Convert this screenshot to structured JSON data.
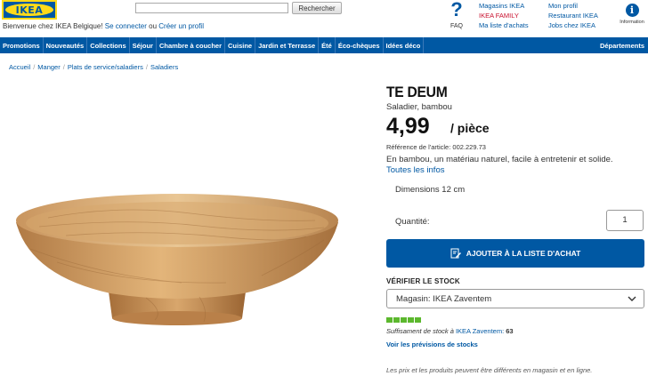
{
  "brand": {
    "logo_text": "IKEA",
    "primary_color": "#0058a3",
    "accent_color": "#ffda1a"
  },
  "header": {
    "welcome_text": "Bienvenue chez IKEA Belgique!",
    "login_link": "Se connecter",
    "or_text": "ou",
    "create_profile_link": "Créer un profil",
    "search_placeholder": "",
    "search_button": "Rechercher",
    "faq_label": "FAQ",
    "links_col1": [
      "Magasins IKEA",
      "IKEA FAMILY",
      "Ma liste d'achats"
    ],
    "links_col2": [
      "Mon profil",
      "Restaurant IKEA",
      "Jobs chez IKEA"
    ],
    "info_label": "Information"
  },
  "nav": {
    "items": [
      "Promotions",
      "Nouveautés",
      "Collections",
      "Séjour",
      "Chambre à coucher",
      "Cuisine",
      "Jardin et Terrasse",
      "Été",
      "Éco-chèques",
      "Idées déco"
    ],
    "right_item": "Départements"
  },
  "breadcrumb": [
    "Accueil",
    "Manger",
    "Plats de service/saladiers",
    "Saladiers"
  ],
  "product": {
    "name": "TE DEUM",
    "description": "Saladier, bambou",
    "price": "4,99",
    "unit": "/ pièce",
    "reference_label": "Référence de l'article:",
    "reference": "002.229.73",
    "material": "En bambou, un matériau naturel, facile à entretenir et solide.",
    "all_info_link": "Toutes les infos",
    "dimensions_label": "Dimensions",
    "dimensions_value": "12 cm",
    "image_icon": "wooden-bowl"
  },
  "purchase": {
    "quantity_label": "Quantité:",
    "quantity_value": "1",
    "add_button": "AJOUTER À LA LISTE D'ACHAT",
    "add_icon": "pencil-list-icon"
  },
  "stock": {
    "title": "VÉRIFIER LE STOCK",
    "store_select": "Magasin: IKEA Zaventem",
    "level_bars": 5,
    "level_color": "#5cb82e",
    "status_text": "Suffisament de stock à",
    "store_link": "IKEA Zaventem:",
    "count": "63",
    "forecast_link": "Voir les prévisions de stocks"
  },
  "footer": {
    "disclaimer": "Les prix et les produits peuvent être différents en magasin et en ligne."
  }
}
